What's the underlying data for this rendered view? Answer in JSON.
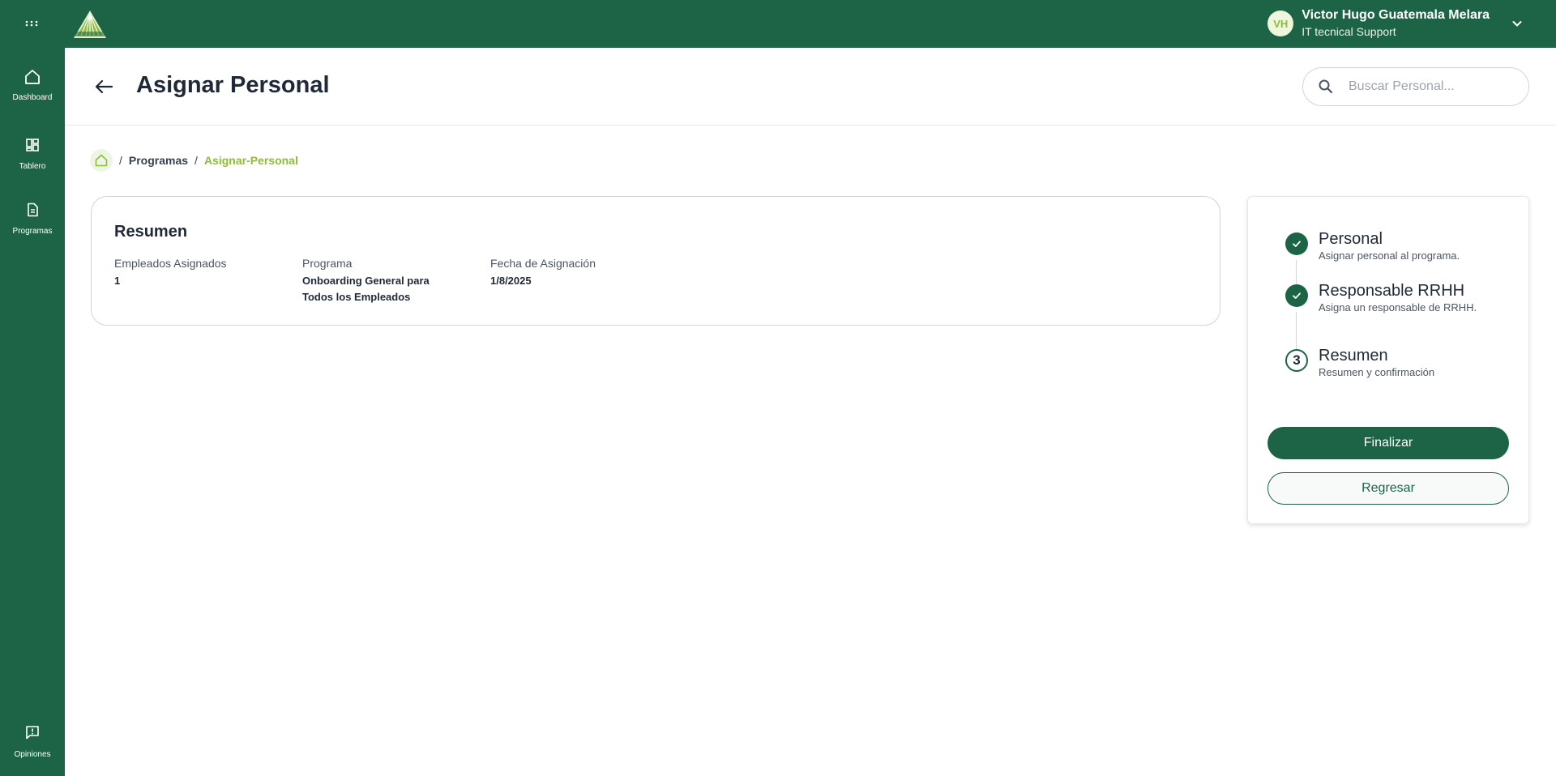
{
  "topbar": {
    "apps_icon": "grid-dots-icon",
    "logo_icon": "aseinfo-logo",
    "user": {
      "initials": "VH",
      "name": "Victor Hugo Guatemala Melara",
      "role": "IT tecnical Support",
      "menu_icon": "chevron-down-icon"
    }
  },
  "sidebar": {
    "items": [
      {
        "label": "Dashboard",
        "icon": "home-icon"
      },
      {
        "label": "Tablero",
        "icon": "board-icon"
      },
      {
        "label": "Programas",
        "icon": "document-icon"
      },
      {
        "label": "Opiniones",
        "icon": "feedback-icon"
      }
    ]
  },
  "header": {
    "title": "Asignar Personal",
    "back_icon": "arrow-left-icon",
    "search": {
      "placeholder": "Buscar Personal...",
      "value": "",
      "icon": "search-icon"
    }
  },
  "breadcrumb": {
    "home_icon": "home-icon",
    "separator": "/",
    "items": [
      "Programas",
      "Asignar-Personal"
    ]
  },
  "summary": {
    "title": "Resumen",
    "fields": [
      {
        "label": "Empleados Asignados",
        "value": "1"
      },
      {
        "label": "Programa",
        "value": "Onboarding General para Todos los Empleados"
      },
      {
        "label": "Fecha de Asignación",
        "value": "1/8/2025"
      }
    ]
  },
  "stepper": {
    "steps": [
      {
        "status": "done",
        "title": "Personal",
        "description": "Asignar personal al programa."
      },
      {
        "status": "done",
        "title": "Responsable RRHH",
        "description": "Asigna un responsable de RRHH."
      },
      {
        "status": "current",
        "number": "3",
        "title": "Resumen",
        "description": "Resumen y confirmación"
      }
    ],
    "finish_label": "Finalizar",
    "back_label": "Regresar"
  },
  "colors": {
    "primary": "#1d6447",
    "accent": "#8cbd3c",
    "background": "#ffffff"
  }
}
